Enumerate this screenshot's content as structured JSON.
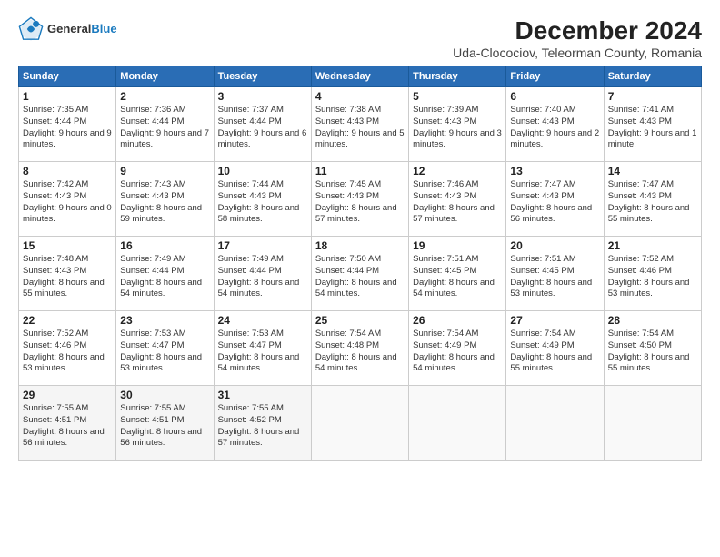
{
  "logo": {
    "general": "General",
    "blue": "Blue"
  },
  "header": {
    "title": "December 2024",
    "subtitle": "Uda-Clocociov, Teleorman County, Romania"
  },
  "weekdays": [
    "Sunday",
    "Monday",
    "Tuesday",
    "Wednesday",
    "Thursday",
    "Friday",
    "Saturday"
  ],
  "weeks": [
    [
      {
        "day": 1,
        "sunrise": "7:35 AM",
        "sunset": "4:44 PM",
        "daylight": "9 hours and 9 minutes."
      },
      {
        "day": 2,
        "sunrise": "7:36 AM",
        "sunset": "4:44 PM",
        "daylight": "9 hours and 7 minutes."
      },
      {
        "day": 3,
        "sunrise": "7:37 AM",
        "sunset": "4:44 PM",
        "daylight": "9 hours and 6 minutes."
      },
      {
        "day": 4,
        "sunrise": "7:38 AM",
        "sunset": "4:43 PM",
        "daylight": "9 hours and 5 minutes."
      },
      {
        "day": 5,
        "sunrise": "7:39 AM",
        "sunset": "4:43 PM",
        "daylight": "9 hours and 3 minutes."
      },
      {
        "day": 6,
        "sunrise": "7:40 AM",
        "sunset": "4:43 PM",
        "daylight": "9 hours and 2 minutes."
      },
      {
        "day": 7,
        "sunrise": "7:41 AM",
        "sunset": "4:43 PM",
        "daylight": "9 hours and 1 minute."
      }
    ],
    [
      {
        "day": 8,
        "sunrise": "7:42 AM",
        "sunset": "4:43 PM",
        "daylight": "9 hours and 0 minutes."
      },
      {
        "day": 9,
        "sunrise": "7:43 AM",
        "sunset": "4:43 PM",
        "daylight": "8 hours and 59 minutes."
      },
      {
        "day": 10,
        "sunrise": "7:44 AM",
        "sunset": "4:43 PM",
        "daylight": "8 hours and 58 minutes."
      },
      {
        "day": 11,
        "sunrise": "7:45 AM",
        "sunset": "4:43 PM",
        "daylight": "8 hours and 57 minutes."
      },
      {
        "day": 12,
        "sunrise": "7:46 AM",
        "sunset": "4:43 PM",
        "daylight": "8 hours and 57 minutes."
      },
      {
        "day": 13,
        "sunrise": "7:47 AM",
        "sunset": "4:43 PM",
        "daylight": "8 hours and 56 minutes."
      },
      {
        "day": 14,
        "sunrise": "7:47 AM",
        "sunset": "4:43 PM",
        "daylight": "8 hours and 55 minutes."
      }
    ],
    [
      {
        "day": 15,
        "sunrise": "7:48 AM",
        "sunset": "4:43 PM",
        "daylight": "8 hours and 55 minutes."
      },
      {
        "day": 16,
        "sunrise": "7:49 AM",
        "sunset": "4:44 PM",
        "daylight": "8 hours and 54 minutes."
      },
      {
        "day": 17,
        "sunrise": "7:49 AM",
        "sunset": "4:44 PM",
        "daylight": "8 hours and 54 minutes."
      },
      {
        "day": 18,
        "sunrise": "7:50 AM",
        "sunset": "4:44 PM",
        "daylight": "8 hours and 54 minutes."
      },
      {
        "day": 19,
        "sunrise": "7:51 AM",
        "sunset": "4:45 PM",
        "daylight": "8 hours and 54 minutes."
      },
      {
        "day": 20,
        "sunrise": "7:51 AM",
        "sunset": "4:45 PM",
        "daylight": "8 hours and 53 minutes."
      },
      {
        "day": 21,
        "sunrise": "7:52 AM",
        "sunset": "4:46 PM",
        "daylight": "8 hours and 53 minutes."
      }
    ],
    [
      {
        "day": 22,
        "sunrise": "7:52 AM",
        "sunset": "4:46 PM",
        "daylight": "8 hours and 53 minutes."
      },
      {
        "day": 23,
        "sunrise": "7:53 AM",
        "sunset": "4:47 PM",
        "daylight": "8 hours and 53 minutes."
      },
      {
        "day": 24,
        "sunrise": "7:53 AM",
        "sunset": "4:47 PM",
        "daylight": "8 hours and 54 minutes."
      },
      {
        "day": 25,
        "sunrise": "7:54 AM",
        "sunset": "4:48 PM",
        "daylight": "8 hours and 54 minutes."
      },
      {
        "day": 26,
        "sunrise": "7:54 AM",
        "sunset": "4:49 PM",
        "daylight": "8 hours and 54 minutes."
      },
      {
        "day": 27,
        "sunrise": "7:54 AM",
        "sunset": "4:49 PM",
        "daylight": "8 hours and 55 minutes."
      },
      {
        "day": 28,
        "sunrise": "7:54 AM",
        "sunset": "4:50 PM",
        "daylight": "8 hours and 55 minutes."
      }
    ],
    [
      {
        "day": 29,
        "sunrise": "7:55 AM",
        "sunset": "4:51 PM",
        "daylight": "8 hours and 56 minutes."
      },
      {
        "day": 30,
        "sunrise": "7:55 AM",
        "sunset": "4:51 PM",
        "daylight": "8 hours and 56 minutes."
      },
      {
        "day": 31,
        "sunrise": "7:55 AM",
        "sunset": "4:52 PM",
        "daylight": "8 hours and 57 minutes."
      },
      null,
      null,
      null,
      null
    ]
  ]
}
